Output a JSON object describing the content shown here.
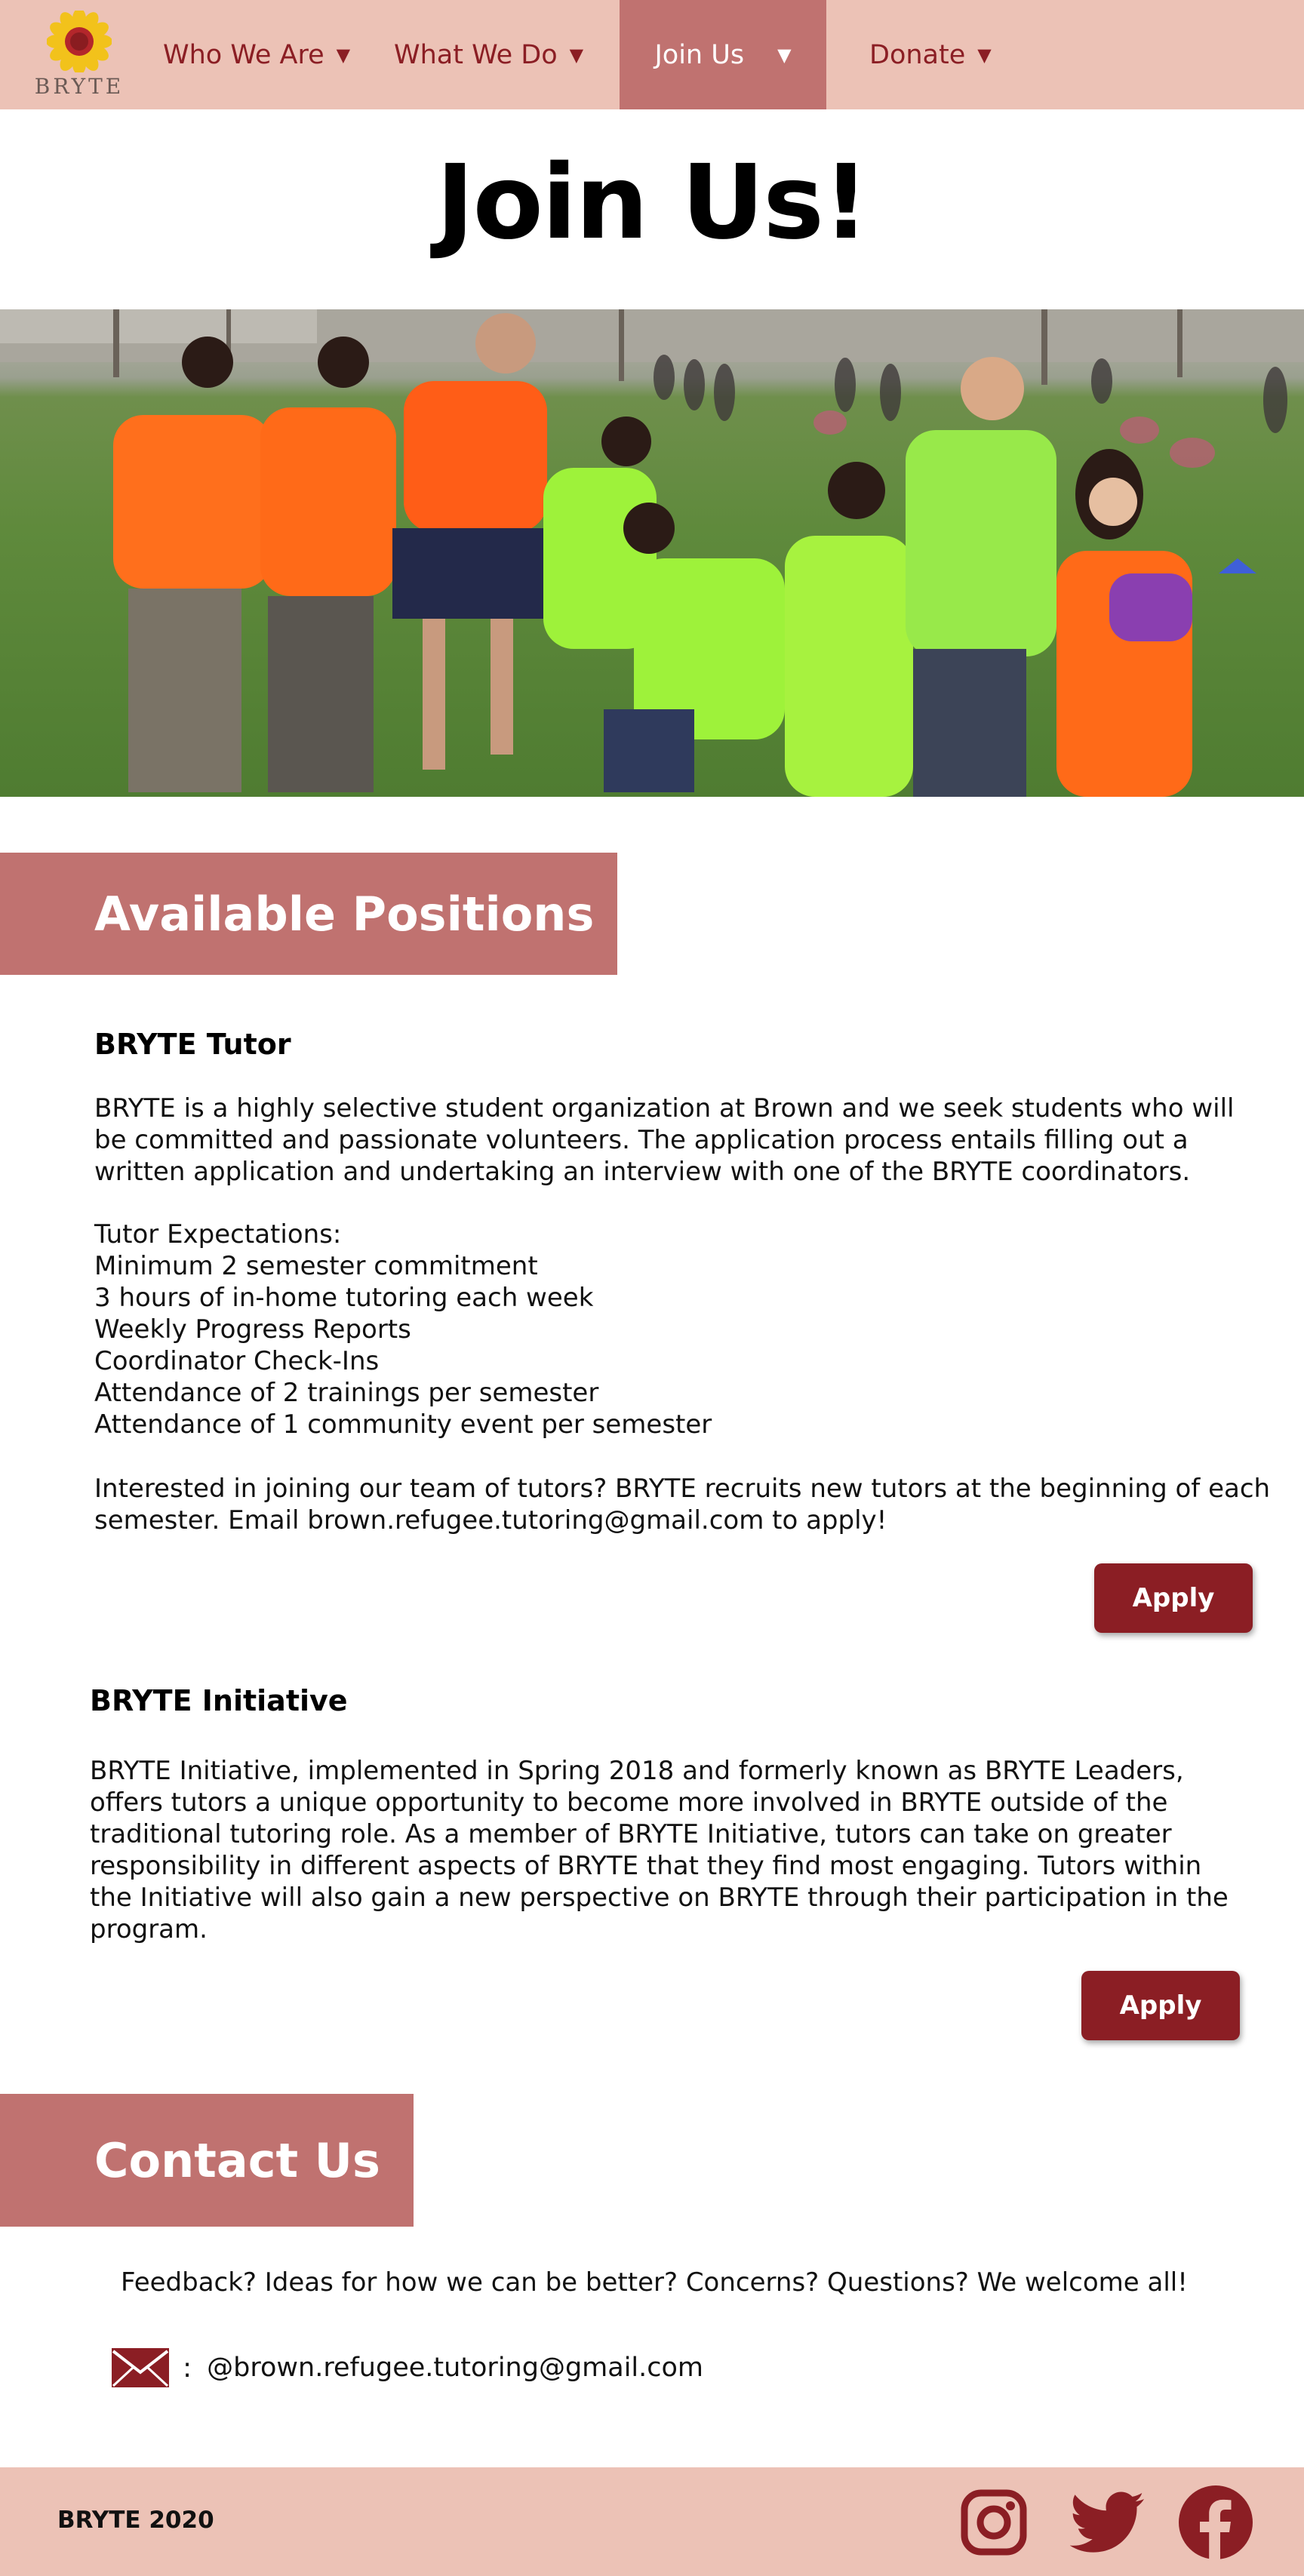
{
  "nav": {
    "logo_text": "BRYTE",
    "items": [
      {
        "label": "Who We Are",
        "caret": "▼"
      },
      {
        "label": "What We Do",
        "caret": "▼"
      },
      {
        "label": "Join Us",
        "caret": "▼"
      },
      {
        "label": "Donate",
        "caret": "▼"
      }
    ],
    "active_index": 2
  },
  "page_title": "Join Us!",
  "sections": {
    "positions_title": "Available Positions",
    "contact_title": "Contact Us"
  },
  "positions": [
    {
      "title": "BRYTE Tutor",
      "description": "BRYTE is a highly selective student organization at Brown and we seek students who will be committed and passionate volunteers. The application process entails filling out a written application and undertaking an interview with one of the BRYTE coordinators.",
      "expectations_heading": "Tutor Expectations:",
      "expectations": [
        "Minimum 2 semester commitment",
        "3 hours of in-home tutoring each week",
        "Weekly Progress Reports",
        "Coordinator Check-Ins",
        "Attendance of 2 trainings per semester",
        "Attendance of 1 community event per semester"
      ],
      "closing": "Interested in joining our team of tutors? BRYTE recruits new tutors at the beginning of each semester. Email brown.refugee.tutoring@gmail.com to apply!",
      "button_label": "Apply"
    },
    {
      "title": "BRYTE Initiative",
      "description": "BRYTE Initiative, implemented in Spring 2018 and formerly known as BRYTE Leaders, offers tutors a unique opportunity to become more involved in BRYTE outside of the traditional tutoring role. As a member of BRYTE Initiative, tutors can take on greater responsibility in different aspects of BRYTE that they find most engaging. Tutors within the Initiative will also gain a new perspective on BRYTE through their participation in the program.",
      "button_label": "Apply"
    }
  ],
  "contact": {
    "text": "Feedback? Ideas for how we can be better? Concerns? Questions? We welcome all!",
    "colon": ":",
    "email": "@brown.refugee.tutoring@gmail.com",
    "icon": "envelope-icon"
  },
  "footer": {
    "copyright": "BRYTE 2020",
    "social_icons": [
      "instagram-icon",
      "twitter-icon",
      "facebook-icon"
    ]
  },
  "colors": {
    "nav_bg": "#ecc2b6",
    "accent": "#c07270",
    "button": "#8b1e24",
    "nav_text": "#8b1e24"
  }
}
